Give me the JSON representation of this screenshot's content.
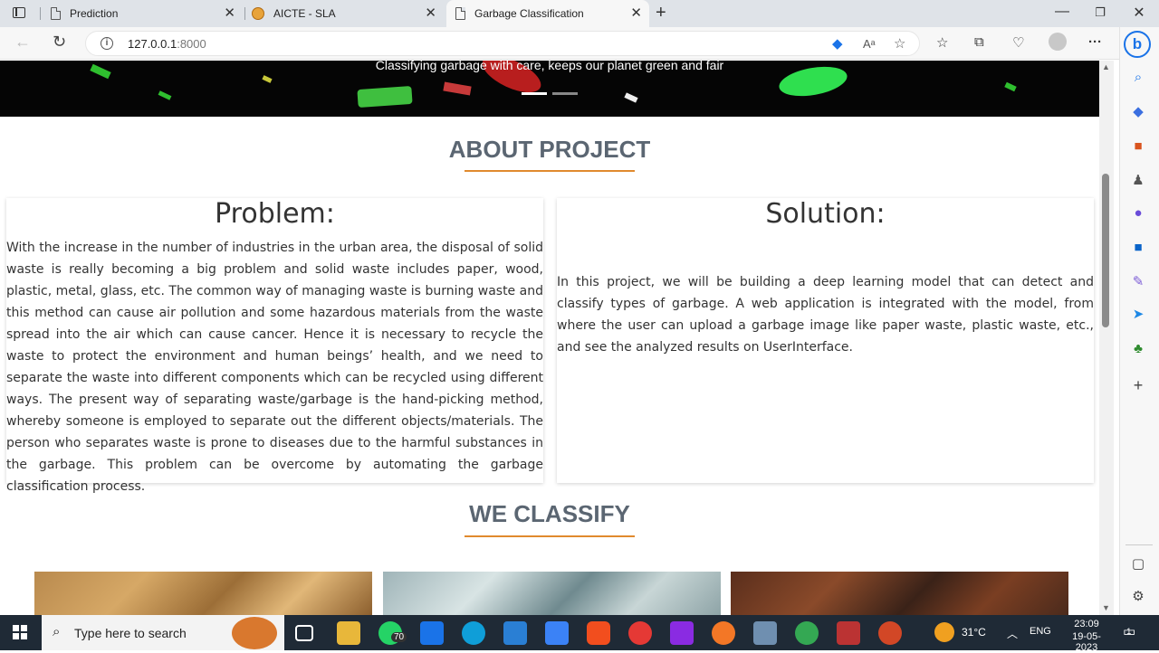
{
  "browser": {
    "tabs": [
      {
        "title": "Prediction"
      },
      {
        "title": "AICTE - SLA"
      },
      {
        "title": "Garbage Classification"
      }
    ],
    "url_host": "127.0.0.1",
    "url_port": ":8000",
    "read_aloud_label": "Aᵃ"
  },
  "hero": {
    "caption": "Classifying garbage with care, keeps our planet green and fair"
  },
  "about": {
    "title": "ABOUT PROJECT",
    "problem_heading": "Problem:",
    "problem_text": "With the increase in the number of industries in the urban area, the disposal of solid waste is really becoming a big problem and solid waste includes paper, wood, plastic, metal, glass, etc. The common way of managing waste is burning waste and this method can cause air pollution and some hazardous materials from the waste spread into the air which can cause cancer. Hence it is necessary to recycle the waste to protect the environment and human beings’ health, and we need to separate the waste into different components which can be recycled using different ways. The present way of separating waste/garbage is the hand-picking method, whereby someone is employed to separate out the different objects/materials. The person who separates waste is prone to diseases due to the harmful substances in the garbage. This problem can be overcome by automating the garbage classification process.",
    "solution_heading": "Solution:",
    "solution_text": "In this project, we will be building a deep learning model that can detect and classify types of garbage. A web application is integrated with the model, from where the user can upload a garbage image like paper waste, plastic waste, etc., and see the analyzed results on UserInterface."
  },
  "classify": {
    "title": "WE CLASSIFY"
  },
  "taskbar": {
    "search_placeholder": "Type here to search",
    "whatsapp_badge": "70",
    "weather": "31°C",
    "language": "ENG",
    "time": "23:09",
    "date": "19-05-2023",
    "notification_count": "1"
  },
  "colors": {
    "accent_orange": "#e08a2e",
    "title_gray": "#5b6672",
    "taskbar_bg": "#1f2a36"
  }
}
